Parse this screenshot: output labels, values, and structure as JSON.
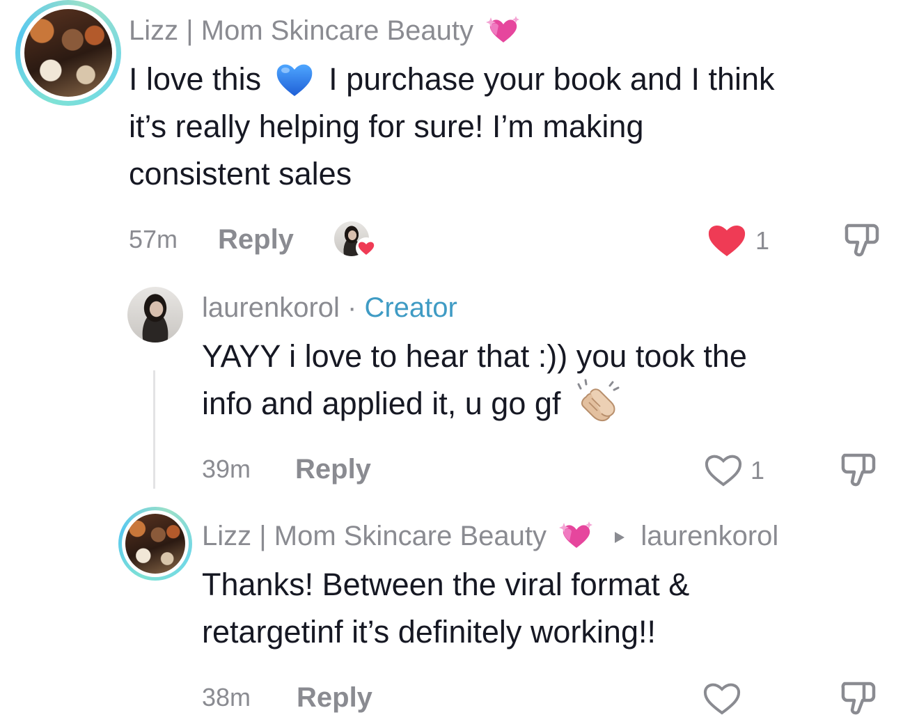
{
  "comments": [
    {
      "username": "Lizz | Mom Skincare Beauty",
      "username_emoji": "sparkling-heart-emoji",
      "text_part1": "I love this",
      "text_emoji": "blue-heart-emoji",
      "text_part2": "I purchase your book and I think",
      "text_line2": "it’s really helping for sure! I’m making",
      "text_line3": "consistent sales",
      "time": "57m",
      "reply_label": "Reply",
      "likes": "1",
      "liked": true,
      "liked_by_creator": true
    },
    {
      "username": "laurenkorol",
      "separator": "·",
      "badge": "Creator",
      "text_line1": "YAYY i love to hear that :)) you took the",
      "text_line2": "info and applied it, u go gf",
      "text_emoji": "clapping-hands-emoji",
      "time": "39m",
      "reply_label": "Reply",
      "likes": "1",
      "liked": false
    },
    {
      "username": "Lizz | Mom Skincare Beauty",
      "username_emoji": "sparkling-heart-emoji",
      "reply_to": "laurenkorol",
      "text_line1": "Thanks! Between the viral format &",
      "text_line2": "retargetinf it’s definitely working!!",
      "time": "38m",
      "reply_label": "Reply",
      "likes": "",
      "liked": false
    }
  ],
  "colors": {
    "like_red": "#ef3b55",
    "creator_blue": "#3f9bc4",
    "meta_gray": "#8a8b91",
    "text_dark": "#161823"
  }
}
